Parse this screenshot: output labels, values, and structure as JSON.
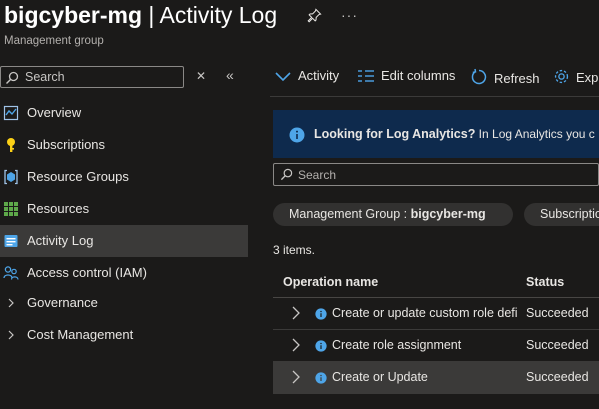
{
  "header": {
    "resource_name": "bigcyber-mg",
    "separator": " | ",
    "blade_title": "Activity Log",
    "subtitle": "Management group",
    "more_label": "···"
  },
  "sidebar": {
    "search_placeholder": "Search",
    "items": [
      {
        "label": "Overview",
        "icon": "overview-icon"
      },
      {
        "label": "Subscriptions",
        "icon": "key-icon"
      },
      {
        "label": "Resource Groups",
        "icon": "resource-group-icon"
      },
      {
        "label": "Resources",
        "icon": "grid-icon"
      },
      {
        "label": "Activity Log",
        "icon": "activity-log-icon",
        "active": true
      },
      {
        "label": "Access control (IAM)",
        "icon": "people-icon"
      },
      {
        "label": "Governance",
        "icon": "chevron-right-icon"
      },
      {
        "label": "Cost Management",
        "icon": "chevron-right-icon"
      }
    ]
  },
  "toolbar": {
    "activity_label": "Activity",
    "edit_columns_label": "Edit columns",
    "refresh_label": "Refresh",
    "export_label": "Exp"
  },
  "banner": {
    "title": "Looking for Log Analytics?",
    "text": " In Log Analytics you c"
  },
  "main": {
    "search_placeholder": "Search",
    "filters": [
      {
        "key": "Management Group : ",
        "value": "bigcyber-mg"
      },
      {
        "key": "Subscriptio",
        "value": ""
      }
    ],
    "count_text": "3 items.",
    "columns": [
      "Operation name",
      "Status"
    ],
    "rows": [
      {
        "operation": "Create or update custom role definition",
        "status": "Succeeded"
      },
      {
        "operation": "Create role assignment",
        "status": "Succeeded"
      },
      {
        "operation": "Create or Update",
        "status": "Succeeded",
        "selected": true
      }
    ]
  },
  "colors": {
    "accent": "#0078d4",
    "banner_bg": "#0e2a4d",
    "selected_bg": "#3b3a39",
    "key_yellow": "#fcd116",
    "grid_green": "#5ea94a"
  }
}
